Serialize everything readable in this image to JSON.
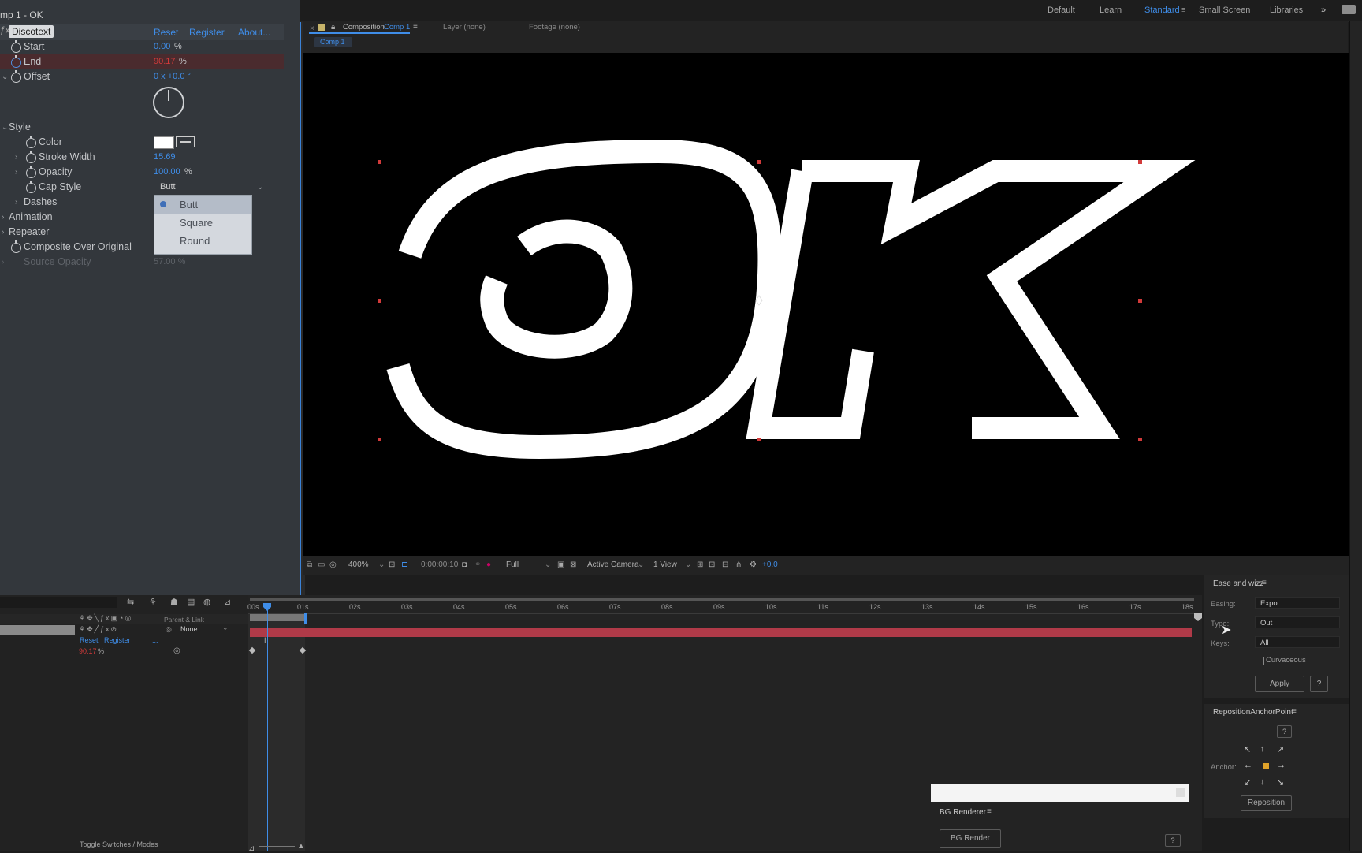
{
  "effect_controls": {
    "header": "mp 1 - OK",
    "effect_name": "Discotext",
    "reset": "Reset",
    "register": "Register",
    "about": "About...",
    "start": {
      "label": "Start",
      "value": "0.00",
      "unit": "%"
    },
    "end": {
      "label": "End",
      "value": "90.17",
      "unit": "%"
    },
    "offset": {
      "label": "Offset",
      "value": "0 x +0.0 °"
    },
    "style_group": "Style",
    "color": {
      "label": "Color"
    },
    "stroke_width": {
      "label": "Stroke Width",
      "value": "15.69"
    },
    "opacity": {
      "label": "Opacity",
      "value": "100.00",
      "unit": "%"
    },
    "cap_style": {
      "label": "Cap Style",
      "value": "Butt",
      "options": [
        "Butt",
        "Square",
        "Round"
      ]
    },
    "dashes": "Dashes",
    "animation": "Animation",
    "repeater": "Repeater",
    "composite": "Composite Over Original",
    "source_opacity": {
      "label": "Source Opacity",
      "value": "57.00 %"
    }
  },
  "workspace": {
    "items": [
      "Default",
      "Learn",
      "Standard",
      "Small Screen",
      "Libraries"
    ]
  },
  "viewer": {
    "tab_prefix": "Composition",
    "tab_comp": "Comp 1",
    "layer_tab": "Layer (none)",
    "footage_tab": "Footage (none)",
    "breadcrumb": "Comp 1",
    "canvas_text": "OK",
    "toolbar": {
      "zoom": "400%",
      "timecode": "0:00:00:10",
      "resolution": "Full",
      "camera": "Active Camera",
      "views": "1 View",
      "exposure": "+0.0"
    }
  },
  "timeline": {
    "ruler": [
      "00s",
      "01s",
      "02s",
      "03s",
      "04s",
      "05s",
      "06s",
      "07s",
      "08s",
      "09s",
      "10s",
      "11s",
      "12s",
      "13s",
      "14s",
      "15s",
      "16s",
      "17s",
      "18s"
    ],
    "parent_link": "Parent & Link",
    "parent_value": "None",
    "reset": "Reset",
    "register": "Register",
    "ellipsis": "...",
    "end_value": "90.17",
    "end_unit": "%",
    "toggle": "Toggle Switches / Modes"
  },
  "ease_panel": {
    "title": "Ease and wizz",
    "easing_label": "Easing:",
    "easing_value": "Expo",
    "type_label": "Type:",
    "type_value": "Out",
    "keys_label": "Keys:",
    "keys_value": "All",
    "curvaceous": "Curvaceous",
    "apply": "Apply",
    "help": "?"
  },
  "anchor_panel": {
    "title": "RepositionAnchorPoint",
    "help": "?",
    "anchor_label": "Anchor:",
    "reposition": "Reposition"
  },
  "bg_renderer": {
    "title": "BG Renderer",
    "button": "BG Render",
    "help": "?"
  },
  "colors": {
    "accent_blue": "#3f8de8",
    "end_red": "#d23a3a",
    "layer_bar": "#b03a48",
    "panel_bg": "#33373c"
  }
}
